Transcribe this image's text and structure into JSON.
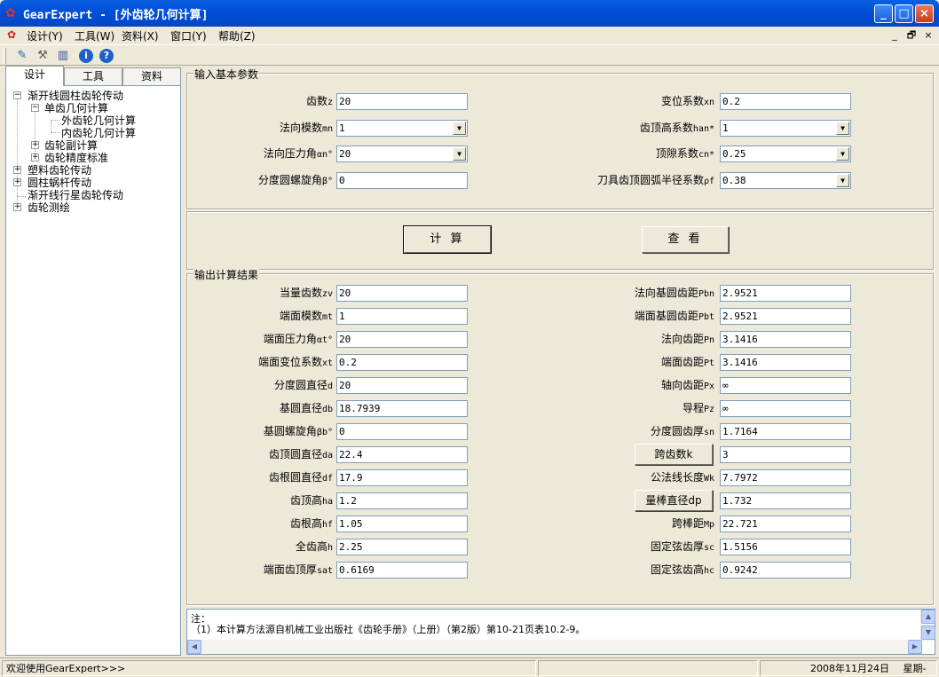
{
  "window": {
    "title": "GearExpert - [外齿轮几何计算]",
    "app_icon": "butterfly-icon",
    "controls": [
      "_",
      "□",
      "×"
    ]
  },
  "menu": {
    "items": [
      "设计(Y)",
      "工具(W)",
      "资料(X)",
      "窗口(Y)",
      "帮助(Z)"
    ],
    "mdi_controls": [
      "_",
      "🗗",
      "×"
    ]
  },
  "toolbar": {
    "icons": [
      "edit-icon",
      "tools-icon",
      "library-icon",
      "info-icon",
      "help-icon"
    ],
    "info_glyph": "i",
    "help_glyph": "?"
  },
  "sidebar": {
    "tabs": [
      "设计",
      "工具",
      "资料"
    ],
    "active_tab": "设计",
    "tree": {
      "node1": "渐开线圆柱齿轮传动",
      "node1_1": "单齿几何计算",
      "node1_1_1": "外齿轮几何计算",
      "node1_1_2": "内齿轮几何计算",
      "node1_2": "齿轮副计算",
      "node1_3": "齿轮精度标准",
      "node2": "塑料齿轮传动",
      "node3": "圆柱蜗杆传动",
      "node4": "渐开线行星齿轮传动",
      "node5": "齿轮测绘"
    }
  },
  "input": {
    "title": "输入基本参数",
    "left": [
      {
        "label": "齿数",
        "sub": "z",
        "value": "20",
        "combo": false
      },
      {
        "label": "法向模数",
        "sub": "mn",
        "value": "1",
        "combo": true
      },
      {
        "label": "法向压力角",
        "sub": "αn°",
        "value": "20",
        "combo": true
      },
      {
        "label": "分度圆螺旋角",
        "sub": "β°",
        "value": "0",
        "combo": false
      }
    ],
    "right": [
      {
        "label": "变位系数",
        "sub": "xn",
        "value": "0.2",
        "combo": false
      },
      {
        "label": "齿顶高系数",
        "sub": "han*",
        "value": "1",
        "combo": true
      },
      {
        "label": "顶隙系数",
        "sub": "cn*",
        "value": "0.25",
        "combo": true
      },
      {
        "label": "刀具齿顶圆弧半径系数",
        "sub": "ρf",
        "value": "0.38",
        "combo": true
      }
    ]
  },
  "actions": {
    "calc": "计 算",
    "view": "查 看"
  },
  "output": {
    "title": "输出计算结果",
    "left": [
      {
        "label": "当量齿数",
        "sub": "zv",
        "value": "20"
      },
      {
        "label": "端面模数",
        "sub": "mt",
        "value": "1"
      },
      {
        "label": "端面压力角",
        "sub": "αt°",
        "value": "20"
      },
      {
        "label": "端面变位系数",
        "sub": "xt",
        "value": "0.2"
      },
      {
        "label": "分度圆直径",
        "sub": "d",
        "value": "20"
      },
      {
        "label": "基圆直径",
        "sub": "db",
        "value": "18.7939"
      },
      {
        "label": "基圆螺旋角",
        "sub": "βb°",
        "value": "0"
      },
      {
        "label": "齿顶圆直径",
        "sub": "da",
        "value": "22.4"
      },
      {
        "label": "齿根圆直径",
        "sub": "df",
        "value": "17.9"
      },
      {
        "label": "齿顶高",
        "sub": "ha",
        "value": "1.2"
      },
      {
        "label": "齿根高",
        "sub": "hf",
        "value": "1.05"
      },
      {
        "label": "全齿高",
        "sub": "h",
        "value": "2.25"
      },
      {
        "label": "端面齿顶厚",
        "sub": "sat",
        "value": "0.6169"
      }
    ],
    "right": [
      {
        "label": "法向基圆齿距",
        "sub": "Pbn",
        "value": "2.9521",
        "button": false
      },
      {
        "label": "端面基圆齿距",
        "sub": "Pbt",
        "value": "2.9521",
        "button": false
      },
      {
        "label": "法向齿距",
        "sub": "Pn",
        "value": "3.1416",
        "button": false
      },
      {
        "label": "端面齿距",
        "sub": "Pt",
        "value": "3.1416",
        "button": false
      },
      {
        "label": "轴向齿距",
        "sub": "Px",
        "value": "∞",
        "button": false
      },
      {
        "label": "导程",
        "sub": "Pz",
        "value": "∞",
        "button": false
      },
      {
        "label": "分度圆齿厚",
        "sub": "sn",
        "value": "1.7164",
        "button": false
      },
      {
        "label": "跨齿数",
        "sub": "k",
        "value": "3",
        "button": true
      },
      {
        "label": "公法线长度",
        "sub": "Wk",
        "value": "7.7972",
        "button": false
      },
      {
        "label": "量棒直径",
        "sub": "dp",
        "value": "1.732",
        "button": true
      },
      {
        "label": "跨棒距",
        "sub": "Mp",
        "value": "22.721",
        "button": false
      },
      {
        "label": "固定弦齿厚",
        "sub": "sc",
        "value": "1.5156",
        "button": false
      },
      {
        "label": "固定弦齿高",
        "sub": "hc",
        "value": "0.9242",
        "button": false
      }
    ]
  },
  "note": {
    "heading": "注：",
    "line1": "（1）本计算方法源自机械工业出版社《齿轮手册》（上册）（第2版）第10-21页表10.2-9。"
  },
  "status": {
    "welcome": "欢迎使用GearExpert>>>",
    "date": "2008年11月24日",
    "weekday": "星期-"
  }
}
